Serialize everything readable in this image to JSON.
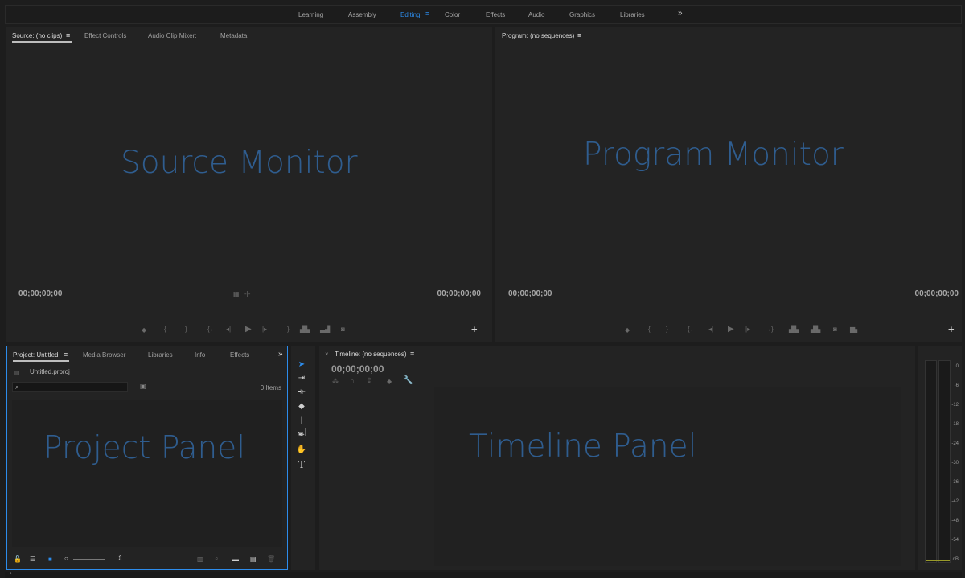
{
  "workspaces": {
    "items": [
      "Learning",
      "Assembly",
      "Editing",
      "Color",
      "Effects",
      "Audio",
      "Graphics",
      "Libraries"
    ],
    "active": "Editing",
    "overflow": "»"
  },
  "source": {
    "tabs": [
      "Source: (no clips)",
      "Effect Controls",
      "Audio Clip Mixer:",
      "Metadata"
    ],
    "overlay": "Source Monitor",
    "timecode_in": "00;00;00;00",
    "timecode_out": "00;00;00;00"
  },
  "program": {
    "tab": "Program: (no sequences)",
    "overlay": "Program Monitor",
    "timecode_in": "00;00;00;00",
    "timecode_out": "00;00;00;00"
  },
  "project": {
    "tabs": [
      "Project: Untitled",
      "Media Browser",
      "Libraries",
      "Info",
      "Effects"
    ],
    "file": "Untitled.prproj",
    "item_count": "0 Items",
    "overlay": "Project Panel"
  },
  "timeline": {
    "tab": "Timeline: (no sequences)",
    "timecode": "00;00;00;00",
    "overlay": "Timeline Panel"
  },
  "meters": {
    "db_labels": [
      "0",
      "-6",
      "-12",
      "-18",
      "-24",
      "-30",
      "-36",
      "-42",
      "-48",
      "-54",
      "dB"
    ]
  },
  "colors": {
    "accent": "#2d8ceb",
    "overlay_text": "#2f5d8f",
    "panel_bg": "#232323"
  }
}
